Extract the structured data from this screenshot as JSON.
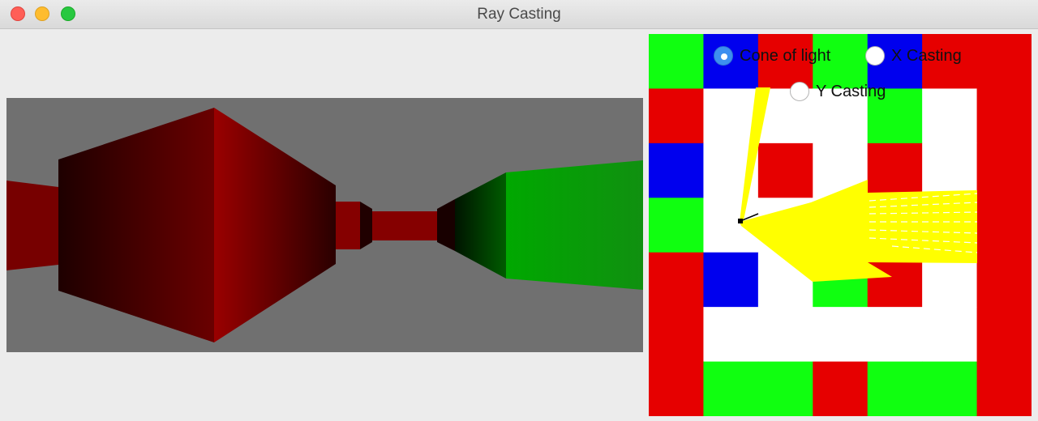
{
  "window": {
    "title": "Ray Casting"
  },
  "options": [
    {
      "label": "Cone of light",
      "checked": true
    },
    {
      "label": "X Casting",
      "checked": false
    },
    {
      "label": "Y Casting",
      "checked": false
    }
  ],
  "colors": {
    "red": "#e60000",
    "green": "#10ff10",
    "blue": "#0000ee",
    "empty": "#ffffff",
    "light_cone": "#ffff00",
    "sky_floor": "#707070"
  },
  "map": {
    "grid": [
      "GBRGBRR",
      "R...G.R",
      "B.R.R.R",
      "G.....R",
      "RB.GR.R",
      "R.....R",
      "RGGRGGR"
    ]
  }
}
